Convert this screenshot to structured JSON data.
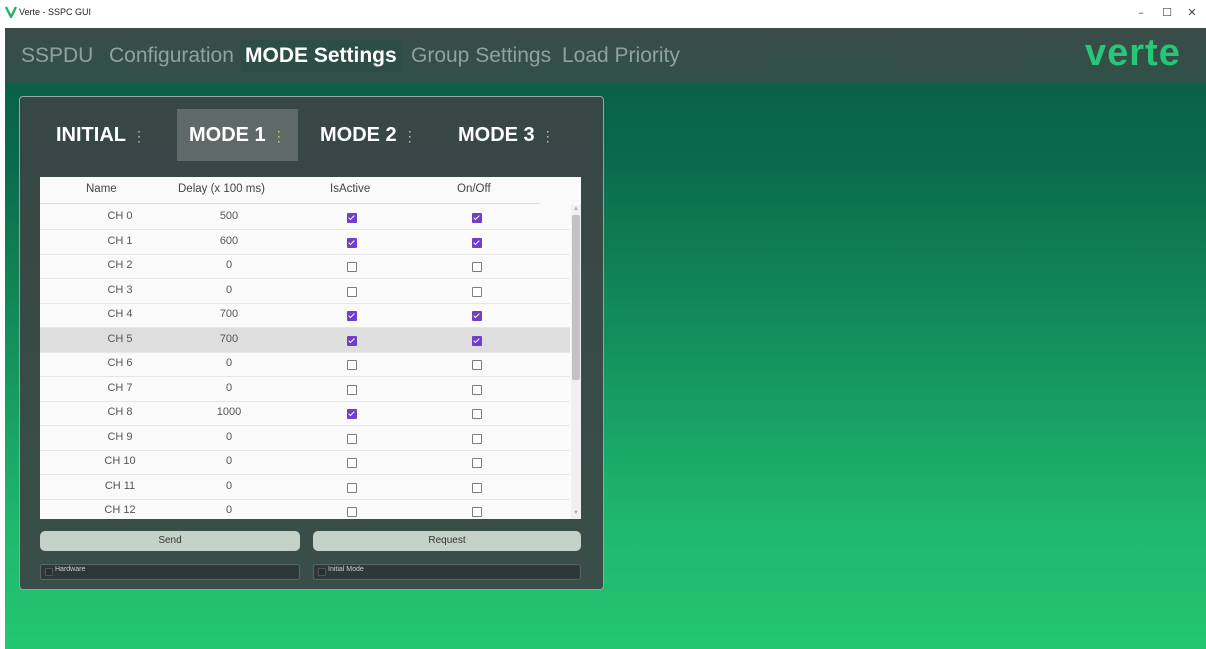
{
  "window": {
    "title": "Verte - SSPC GUI",
    "controls": {
      "minimize": "–",
      "maximize": "☐",
      "close": "✕"
    }
  },
  "nav": {
    "tabs": [
      {
        "label": "SSPDU"
      },
      {
        "label": "Configuration"
      },
      {
        "label": "MODE Settings",
        "active": true
      },
      {
        "label": "Group Settings"
      },
      {
        "label": "Load Priority"
      }
    ],
    "brand": "verte"
  },
  "modes": {
    "tabs": [
      {
        "label": "INITIAL"
      },
      {
        "label": "MODE 1",
        "active": true
      },
      {
        "label": "MODE 2"
      },
      {
        "label": "MODE 3"
      }
    ],
    "menu_glyph": "⋮"
  },
  "table": {
    "columns": [
      "Name",
      "Delay (x 100 ms)",
      "IsActive",
      "On/Off"
    ],
    "rows": [
      {
        "name": "CH 0",
        "delay": "500",
        "active": true,
        "on": true
      },
      {
        "name": "CH 1",
        "delay": "600",
        "active": true,
        "on": true
      },
      {
        "name": "CH 2",
        "delay": "0",
        "active": false,
        "on": false
      },
      {
        "name": "CH 3",
        "delay": "0",
        "active": false,
        "on": false
      },
      {
        "name": "CH 4",
        "delay": "700",
        "active": true,
        "on": true
      },
      {
        "name": "CH 5",
        "delay": "700",
        "active": true,
        "on": true,
        "selected": true
      },
      {
        "name": "CH 6",
        "delay": "0",
        "active": false,
        "on": false
      },
      {
        "name": "CH 7",
        "delay": "0",
        "active": false,
        "on": false
      },
      {
        "name": "CH 8",
        "delay": "1000",
        "active": true,
        "on": false
      },
      {
        "name": "CH 9",
        "delay": "0",
        "active": false,
        "on": false
      },
      {
        "name": "CH 10",
        "delay": "0",
        "active": false,
        "on": false
      },
      {
        "name": "CH 11",
        "delay": "0",
        "active": false,
        "on": false
      },
      {
        "name": "CH 12",
        "delay": "0",
        "active": false,
        "on": false
      }
    ]
  },
  "actions": {
    "send_label": "Send",
    "request_label": "Request",
    "hardware_label": "Hardware",
    "initial_mode_label": "Initial Mode"
  },
  "colors": {
    "accent": "#26c778",
    "checkbox": "#6e3fc8",
    "kebab_active": "#b9e24a"
  }
}
